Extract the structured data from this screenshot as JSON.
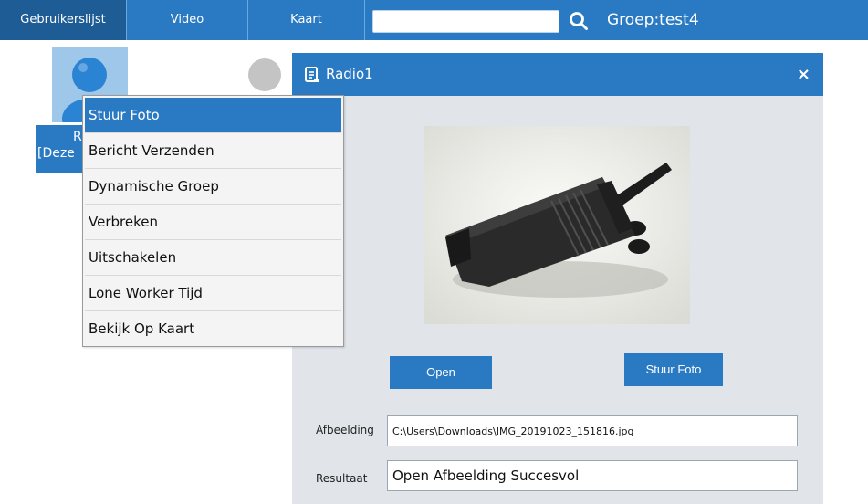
{
  "topbar": {
    "tabs": [
      {
        "label": "Gebruikerslijst"
      },
      {
        "label": "Video"
      },
      {
        "label": "Kaart"
      }
    ],
    "search": {
      "value": "",
      "placeholder": ""
    },
    "search_icon": "search-icon",
    "group_label": "Groep:test4"
  },
  "users": {
    "selected": {
      "name_line1": "Ra",
      "name_line2": "[Deze"
    }
  },
  "context_menu": {
    "items": [
      {
        "label": "Stuur Foto"
      },
      {
        "label": "Bericht Verzenden"
      },
      {
        "label": "Dynamische Groep"
      },
      {
        "label": "Verbreken"
      },
      {
        "label": "Uitschakelen"
      },
      {
        "label": "Lone Worker Tijd"
      },
      {
        "label": "Bekijk Op Kaart"
      }
    ]
  },
  "dialog": {
    "title": "Radio1",
    "close": "×",
    "open_button": "Open",
    "send_button": "Stuur Foto",
    "image_label": "Afbeelding",
    "image_path": "C:\\Users\\Downloads\\IMG_20191023_151816.jpg",
    "result_label": "Resultaat",
    "result_value": "Open Afbeelding Succesvol"
  },
  "colors": {
    "accent": "#2a7ac3",
    "dialog_bg": "#e1e5ea",
    "tile_bg": "#9ec7ea"
  }
}
